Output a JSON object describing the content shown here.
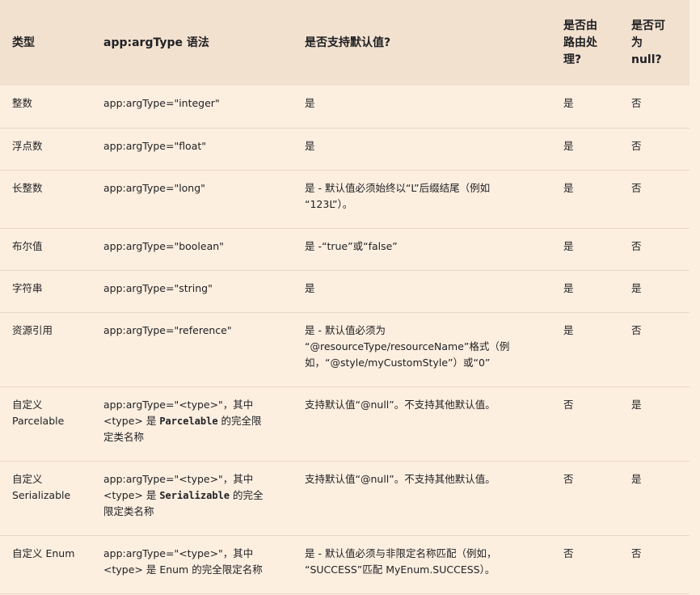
{
  "headers": {
    "type": "类型",
    "syntax": "app:argType 语法",
    "default": "是否支持默认值?",
    "route_line1": "是否由",
    "route_line2": "路由处",
    "route_line3": "理?",
    "null_line1": "是否可",
    "null_line2": "为",
    "null_line3": "null?"
  },
  "rows": [
    {
      "type": "整数",
      "syntax": "app:argType=\"integer\"",
      "default": "是",
      "route": "是",
      "nullable": "否"
    },
    {
      "type": "浮点数",
      "syntax": "app:argType=\"float\"",
      "default": "是",
      "route": "是",
      "nullable": "否"
    },
    {
      "type": "长整数",
      "syntax": "app:argType=\"long\"",
      "default_l1": "是 - 默认值必须始终以“L”后缀结尾（例如",
      "default_l2": "“123L”）。",
      "route": "是",
      "nullable": "否"
    },
    {
      "type": "布尔值",
      "syntax": "app:argType=\"boolean\"",
      "default": "是 -“true”或“false”",
      "route": "是",
      "nullable": "否"
    },
    {
      "type": "字符串",
      "syntax": "app:argType=\"string\"",
      "default": "是",
      "route": "是",
      "nullable": "是"
    },
    {
      "type": "资源引用",
      "syntax": "app:argType=\"reference\"",
      "default_l1": "是 - 默认值必须为",
      "default_l2": "“@resourceType/resourceName”格式（例",
      "default_l3": "如，“@style/myCustomStyle”）或“0”",
      "route": "是",
      "nullable": "否"
    },
    {
      "type_l1": "自定义",
      "type_l2": "Parcelable",
      "syntax_l1": "app:argType=\"<type>\"，其中",
      "syntax_l2_a": "<type> 是 ",
      "syntax_l2_code": "Parcelable",
      "syntax_l2_b": " 的完全限",
      "syntax_l3": "定类名称",
      "default": "支持默认值“@null”。不支持其他默认值。",
      "route": "否",
      "nullable": "是"
    },
    {
      "type_l1": "自定义",
      "type_l2": "Serializable",
      "syntax_l1": "app:argType=\"<type>\"，其中",
      "syntax_l2_a": "<type> 是 ",
      "syntax_l2_code": "Serializable",
      "syntax_l2_b": " 的完全",
      "syntax_l3": "限定类名称",
      "default": "支持默认值“@null”。不支持其他默认值。",
      "route": "否",
      "nullable": "是"
    },
    {
      "type": "自定义 Enum",
      "syntax_l1": "app:argType=\"<type>\"，其中",
      "syntax_l2": "<type> 是 Enum 的完全限定名称",
      "default_l1": "是 - 默认值必须与非限定名称匹配（例如，",
      "default_l2": "“SUCCESS”匹配 MyEnum.SUCCESS）。",
      "route": "否",
      "nullable": "否"
    }
  ]
}
